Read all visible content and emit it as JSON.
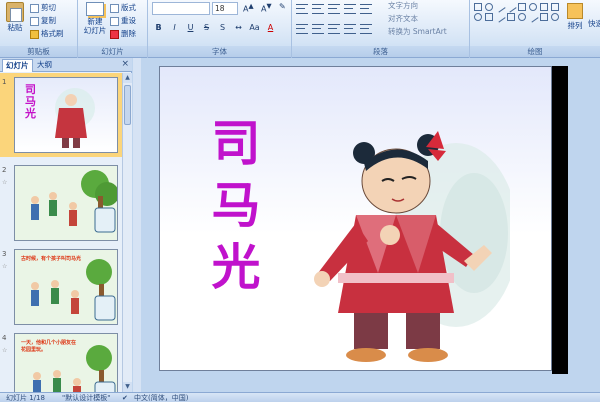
{
  "ribbon": {
    "clipboard": {
      "paste": "粘贴",
      "cut": "剪切",
      "copy": "复制",
      "format_painter": "格式刷",
      "group_label": "剪贴板"
    },
    "slides": {
      "new_slide_line1": "新建",
      "new_slide_line2": "幻灯片",
      "layout": "版式",
      "reset": "重设",
      "delete": "删除",
      "group_label": "幻灯片"
    },
    "font": {
      "font_name": "",
      "font_size": "18",
      "bold": "B",
      "italic": "I",
      "underline": "U",
      "strike": "S",
      "shadow": "S",
      "group_label": "字体"
    },
    "paragraph": {
      "text_direction": "文字方向",
      "align_text": "对齐文本",
      "convert_smartart": "转换为 SmartArt",
      "group_label": "段落"
    },
    "drawing": {
      "arrange": "排列",
      "quick_styles": "快速",
      "group_label": "绘图"
    }
  },
  "panel": {
    "tabs": [
      "幻灯片",
      "大纲"
    ],
    "close": "×",
    "thumbnails": [
      {
        "number": "1",
        "title": "司马光",
        "selected": true
      },
      {
        "number": "2",
        "selected": false
      },
      {
        "number": "3",
        "caption": "古时候，有个孩子叫司马光",
        "selected": false
      },
      {
        "number": "4",
        "caption": "一天，他和几个小朋友在",
        "caption2": "花园里玩。",
        "selected": false
      }
    ]
  },
  "slide": {
    "title": "司马光"
  },
  "status": {
    "slide_count": "幻灯片 1/18",
    "theme": "\"默认设计模板\"",
    "language": "中文(简体，中国)"
  },
  "colors": {
    "title_color": "#c012cc",
    "ribbon_bg": "#dbe8f7",
    "selected_thumb": "#fbd57b"
  }
}
